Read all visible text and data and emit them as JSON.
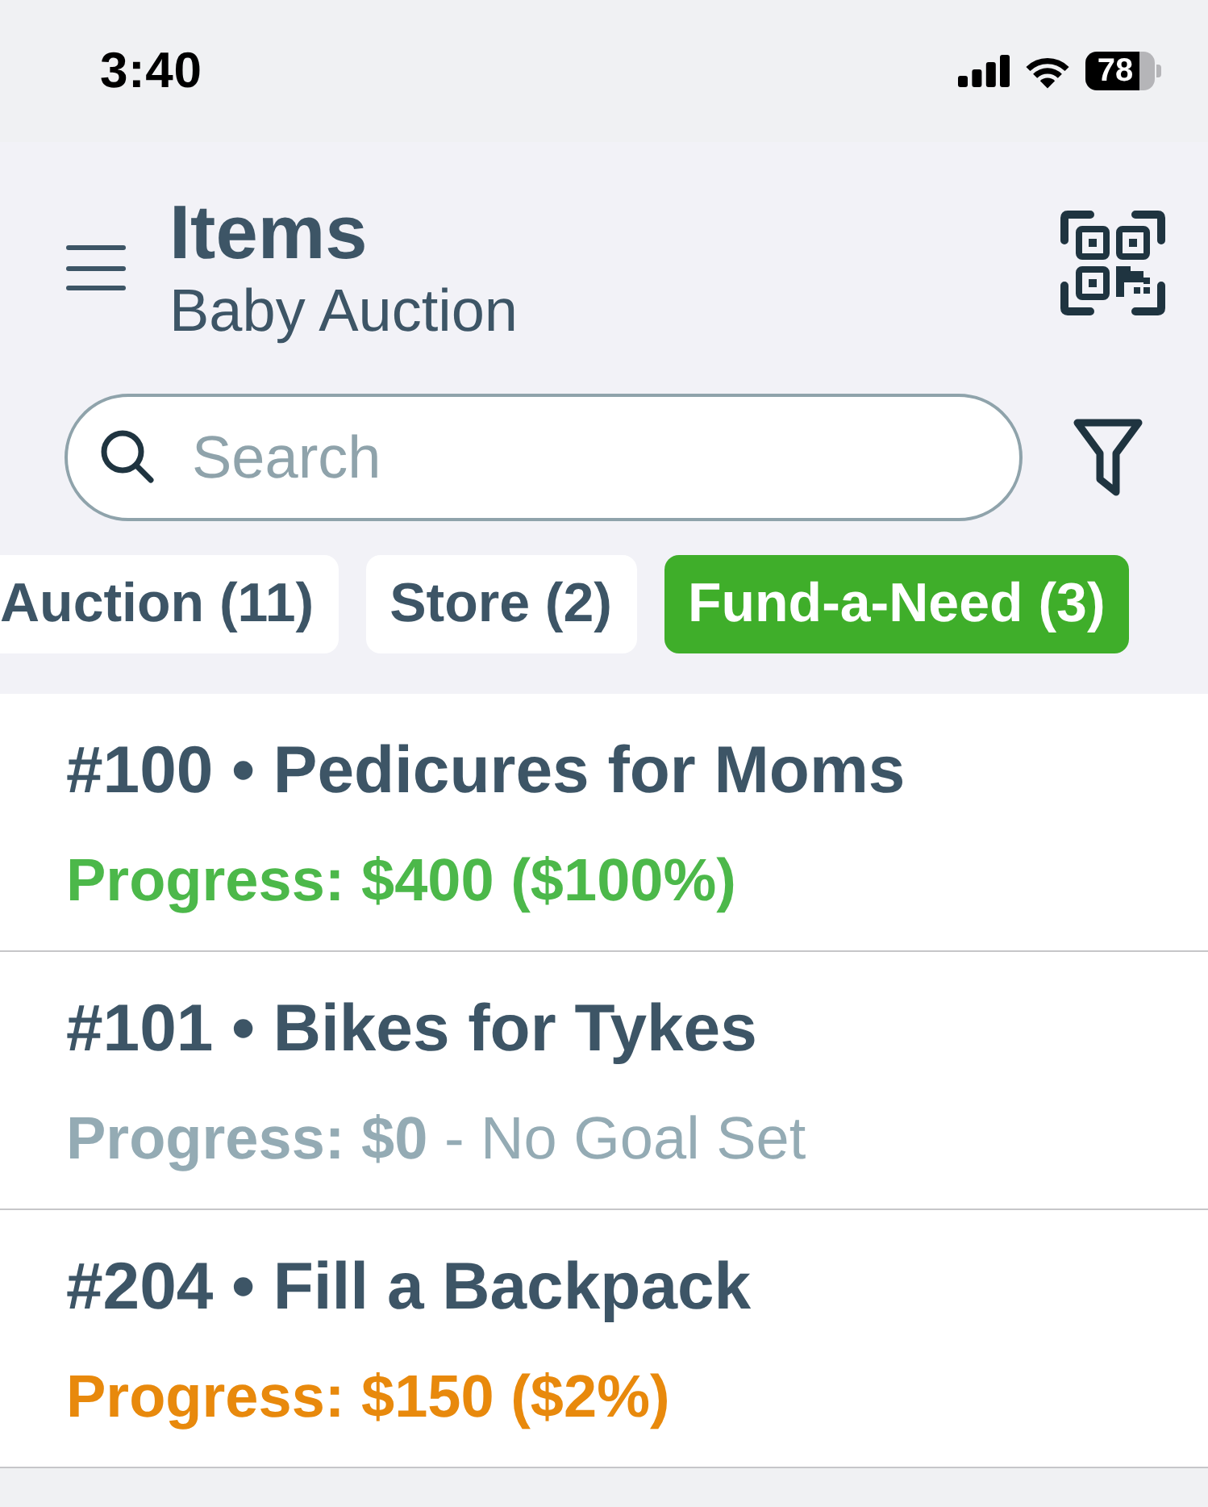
{
  "status_bar": {
    "time": "3:40",
    "battery": "78"
  },
  "header": {
    "title": "Items",
    "subtitle": "Baby Auction"
  },
  "search": {
    "placeholder": "Search"
  },
  "tabs": [
    {
      "label": "Auction (11)",
      "selected": false
    },
    {
      "label": "Store (2)",
      "selected": false
    },
    {
      "label": "Fund-a-Need (3)",
      "selected": true
    }
  ],
  "items": [
    {
      "title": "#100 • Pedicures for Moms",
      "progress": "Progress: $400 ($100%)",
      "color": "#4cb84a"
    },
    {
      "title": "#101 • Bikes for Tykes",
      "progress": "Progress: $0",
      "note": "- No Goal Set",
      "color": "#94abb4"
    },
    {
      "title": "#204 • Fill a Backpack",
      "progress": "Progress: $150 ($2%)",
      "color": "#e8890c"
    }
  ]
}
